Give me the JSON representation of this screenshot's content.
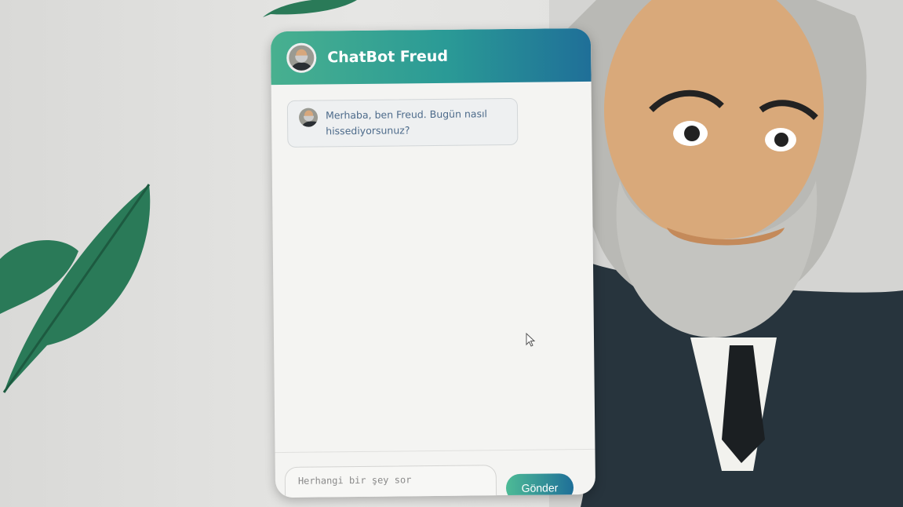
{
  "chat": {
    "title": "ChatBot Freud",
    "messages": [
      {
        "sender": "bot",
        "text": "Merhaba, ben Freud. Bugün nasıl hissediyorsunuz?"
      }
    ],
    "input": {
      "placeholder": "Herhangi bir şey sor",
      "value": ""
    },
    "send_label": "Gönder"
  },
  "colors": {
    "header_start": "#48b08f",
    "header_end": "#1f6f98",
    "leaf": "#2a7a58"
  }
}
